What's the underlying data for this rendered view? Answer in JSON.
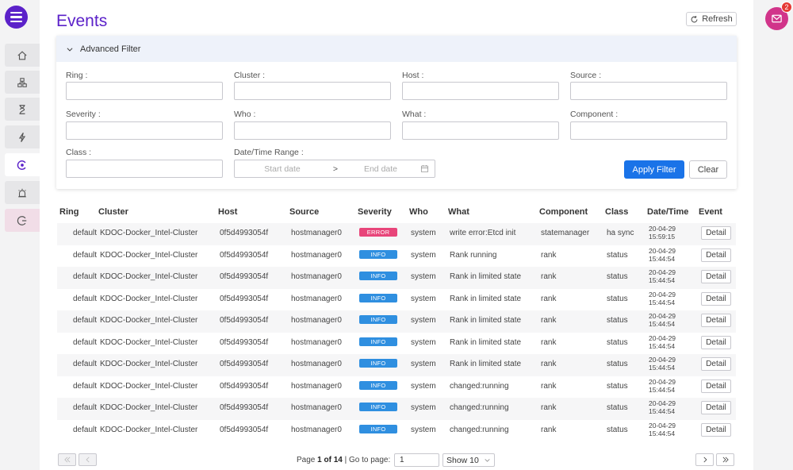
{
  "page": {
    "title": "Events",
    "refresh_label": "Refresh"
  },
  "notifications": {
    "count": "2"
  },
  "filter": {
    "title": "Advanced Filter",
    "fields": {
      "ring": "Ring",
      "cluster": "Cluster",
      "host": "Host",
      "source": "Source",
      "severity": "Severity",
      "who": "Who",
      "what": "What",
      "component": "Component",
      "class": "Class",
      "datetime": "Date/Time Range"
    },
    "date_start_placeholder": "Start date",
    "date_separator": ">",
    "date_end_placeholder": "End date",
    "apply_label": "Apply Filter",
    "clear_label": "Clear"
  },
  "table": {
    "columns": [
      "Ring",
      "Cluster",
      "Host",
      "Source",
      "Severity",
      "Who",
      "What",
      "Component",
      "Class",
      "Date/Time",
      "Event"
    ],
    "detail_label": "Detail",
    "severity_colors": {
      "ERROR": "#e8457a",
      "INFO": "#2f8fe0"
    },
    "rows": [
      {
        "ring": "default",
        "cluster": "KDOC-Docker_Intel-Cluster",
        "host": "0f5d4993054f",
        "source": "hostmanager0",
        "severity": "ERROR",
        "who": "system",
        "what": "write error:Etcd init",
        "component": "statemanager",
        "class": "ha sync",
        "date": "20-04-29",
        "time": "15:59:15"
      },
      {
        "ring": "default",
        "cluster": "KDOC-Docker_Intel-Cluster",
        "host": "0f5d4993054f",
        "source": "hostmanager0",
        "severity": "INFO",
        "who": "system",
        "what": "Rank running",
        "component": "rank",
        "class": "status",
        "date": "20-04-29",
        "time": "15:44:54"
      },
      {
        "ring": "default",
        "cluster": "KDOC-Docker_Intel-Cluster",
        "host": "0f5d4993054f",
        "source": "hostmanager0",
        "severity": "INFO",
        "who": "system",
        "what": "Rank in limited state",
        "component": "rank",
        "class": "status",
        "date": "20-04-29",
        "time": "15:44:54"
      },
      {
        "ring": "default",
        "cluster": "KDOC-Docker_Intel-Cluster",
        "host": "0f5d4993054f",
        "source": "hostmanager0",
        "severity": "INFO",
        "who": "system",
        "what": "Rank in limited state",
        "component": "rank",
        "class": "status",
        "date": "20-04-29",
        "time": "15:44:54"
      },
      {
        "ring": "default",
        "cluster": "KDOC-Docker_Intel-Cluster",
        "host": "0f5d4993054f",
        "source": "hostmanager0",
        "severity": "INFO",
        "who": "system",
        "what": "Rank in limited state",
        "component": "rank",
        "class": "status",
        "date": "20-04-29",
        "time": "15:44:54"
      },
      {
        "ring": "default",
        "cluster": "KDOC-Docker_Intel-Cluster",
        "host": "0f5d4993054f",
        "source": "hostmanager0",
        "severity": "INFO",
        "who": "system",
        "what": "Rank in limited state",
        "component": "rank",
        "class": "status",
        "date": "20-04-29",
        "time": "15:44:54"
      },
      {
        "ring": "default",
        "cluster": "KDOC-Docker_Intel-Cluster",
        "host": "0f5d4993054f",
        "source": "hostmanager0",
        "severity": "INFO",
        "who": "system",
        "what": "Rank in limited state",
        "component": "rank",
        "class": "status",
        "date": "20-04-29",
        "time": "15:44:54"
      },
      {
        "ring": "default",
        "cluster": "KDOC-Docker_Intel-Cluster",
        "host": "0f5d4993054f",
        "source": "hostmanager0",
        "severity": "INFO",
        "who": "system",
        "what": "changed:running",
        "component": "rank",
        "class": "status",
        "date": "20-04-29",
        "time": "15:44:54"
      },
      {
        "ring": "default",
        "cluster": "KDOC-Docker_Intel-Cluster",
        "host": "0f5d4993054f",
        "source": "hostmanager0",
        "severity": "INFO",
        "who": "system",
        "what": "changed:running",
        "component": "rank",
        "class": "status",
        "date": "20-04-29",
        "time": "15:44:54"
      },
      {
        "ring": "default",
        "cluster": "KDOC-Docker_Intel-Cluster",
        "host": "0f5d4993054f",
        "source": "hostmanager0",
        "severity": "INFO",
        "who": "system",
        "what": "changed:running",
        "component": "rank",
        "class": "status",
        "date": "20-04-29",
        "time": "15:44:54"
      }
    ]
  },
  "pagination": {
    "page_prefix": "Page",
    "page_current": "1",
    "page_of": "of",
    "page_total": "14",
    "goto_label": "| Go to page:",
    "goto_value": "1",
    "show_label": "Show 10"
  },
  "colors": {
    "brand": "#5b21c9",
    "accent": "#1a73e8",
    "notification": "#d1348a"
  }
}
